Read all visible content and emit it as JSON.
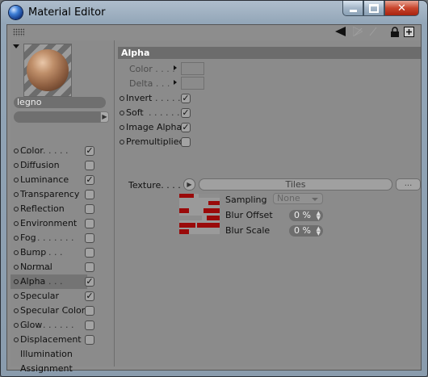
{
  "window": {
    "title": "Material Editor"
  },
  "material": {
    "name": "legno"
  },
  "channels": [
    {
      "label": "Color",
      "dots": " . . . . . . . . .",
      "checked": true
    },
    {
      "label": "Diffusion",
      "dots": " . . . . .",
      "checked": false
    },
    {
      "label": "Luminance",
      "dots": " . . .",
      "checked": true
    },
    {
      "label": "Transparency",
      "dots": "",
      "checked": false
    },
    {
      "label": "Reflection",
      "dots": " . . . .",
      "checked": false
    },
    {
      "label": "Environment",
      "dots": "",
      "checked": false
    },
    {
      "label": "Fog",
      "dots": " . . . . . . . . . .",
      "checked": false
    },
    {
      "label": "Bump",
      "dots": " . . . . . . . .",
      "checked": false
    },
    {
      "label": "Normal",
      "dots": " . . . . . .",
      "checked": false
    },
    {
      "label": "Alpha",
      "dots": " . . . . . . . .",
      "checked": true,
      "selected": true
    },
    {
      "label": "Specular",
      "dots": " . . . . .",
      "checked": true
    },
    {
      "label": "Specular Color",
      "dots": "",
      "checked": false
    },
    {
      "label": "Glow",
      "dots": " . . . . . . . . . .",
      "checked": false
    },
    {
      "label": "Displacement",
      "dots": "",
      "checked": false
    },
    {
      "label": "Illumination",
      "dots": "",
      "checked": null
    },
    {
      "label": "Assignment",
      "dots": "",
      "checked": null
    }
  ],
  "panel": {
    "header": "Alpha",
    "color_label": "Color . . . .",
    "delta_label": "Delta . . .",
    "options": [
      {
        "label": "Invert",
        "dots": " . . . . . .",
        "checked": true
      },
      {
        "label": "Soft",
        "dots": " . . . . . . .",
        "checked": true
      },
      {
        "label": "Image Alpha",
        "dots": "",
        "checked": true
      },
      {
        "label": "Premultiplied",
        "dots": "",
        "checked": false
      }
    ],
    "texture_label": "Texture. . . .",
    "texture_name": "Tiles",
    "texture_more": "...",
    "sampling_label": "Sampling",
    "sampling_value": "None",
    "blur_offset_label": "Blur Offset",
    "blur_offset_value": "0 %",
    "blur_scale_label": "Blur Scale",
    "blur_scale_value": "0 %"
  },
  "icons": {
    "min": "minimize-icon",
    "max": "maximize-icon",
    "close": "close-icon",
    "back": "back-arrow-icon",
    "forward": "forward-arrow-icon",
    "lock": "lock-icon",
    "new": "new-window-icon"
  },
  "colors": {
    "accent_red": "#9a0a0a",
    "close_red": "#c8452c"
  }
}
